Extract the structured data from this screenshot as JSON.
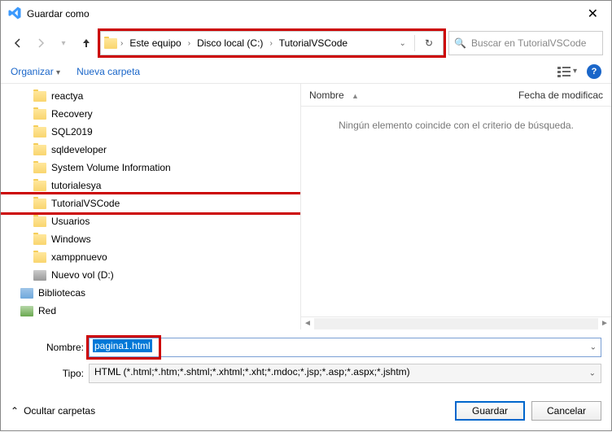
{
  "title": "Guardar como",
  "breadcrumb": {
    "seg0": "Este equipo",
    "seg1": "Disco local (C:)",
    "seg2": "TutorialVSCode"
  },
  "search": {
    "placeholder": "Buscar en TutorialVSCode"
  },
  "toolbar": {
    "organize": "Organizar",
    "newfolder": "Nueva carpeta"
  },
  "tree": {
    "items": [
      {
        "label": "reactya",
        "icon": "folder"
      },
      {
        "label": "Recovery",
        "icon": "folder"
      },
      {
        "label": "SQL2019",
        "icon": "folder"
      },
      {
        "label": "sqldeveloper",
        "icon": "folder"
      },
      {
        "label": "System Volume Information",
        "icon": "folder"
      },
      {
        "label": "tutorialesya",
        "icon": "folder"
      },
      {
        "label": "TutorialVSCode",
        "icon": "folder",
        "highlight": true
      },
      {
        "label": "Usuarios",
        "icon": "folder"
      },
      {
        "label": "Windows",
        "icon": "folder"
      },
      {
        "label": "xamppnuevo",
        "icon": "folder"
      },
      {
        "label": "Nuevo vol (D:)",
        "icon": "hdd"
      },
      {
        "label": "Bibliotecas",
        "icon": "lib",
        "outdent": true
      },
      {
        "label": "Red",
        "icon": "net",
        "outdent": true
      }
    ]
  },
  "filepane": {
    "col_name": "Nombre",
    "col_date": "Fecha de modificac",
    "empty_msg": "Ningún elemento coincide con el criterio de búsqueda."
  },
  "form": {
    "name_label": "Nombre:",
    "name_value": "pagina1.html",
    "type_label": "Tipo:",
    "type_value": "HTML (*.html;*.htm;*.shtml;*.xhtml;*.xht;*.mdoc;*.jsp;*.asp;*.aspx;*.jshtm)"
  },
  "footer": {
    "hide": "Ocultar carpetas",
    "save": "Guardar",
    "cancel": "Cancelar"
  }
}
